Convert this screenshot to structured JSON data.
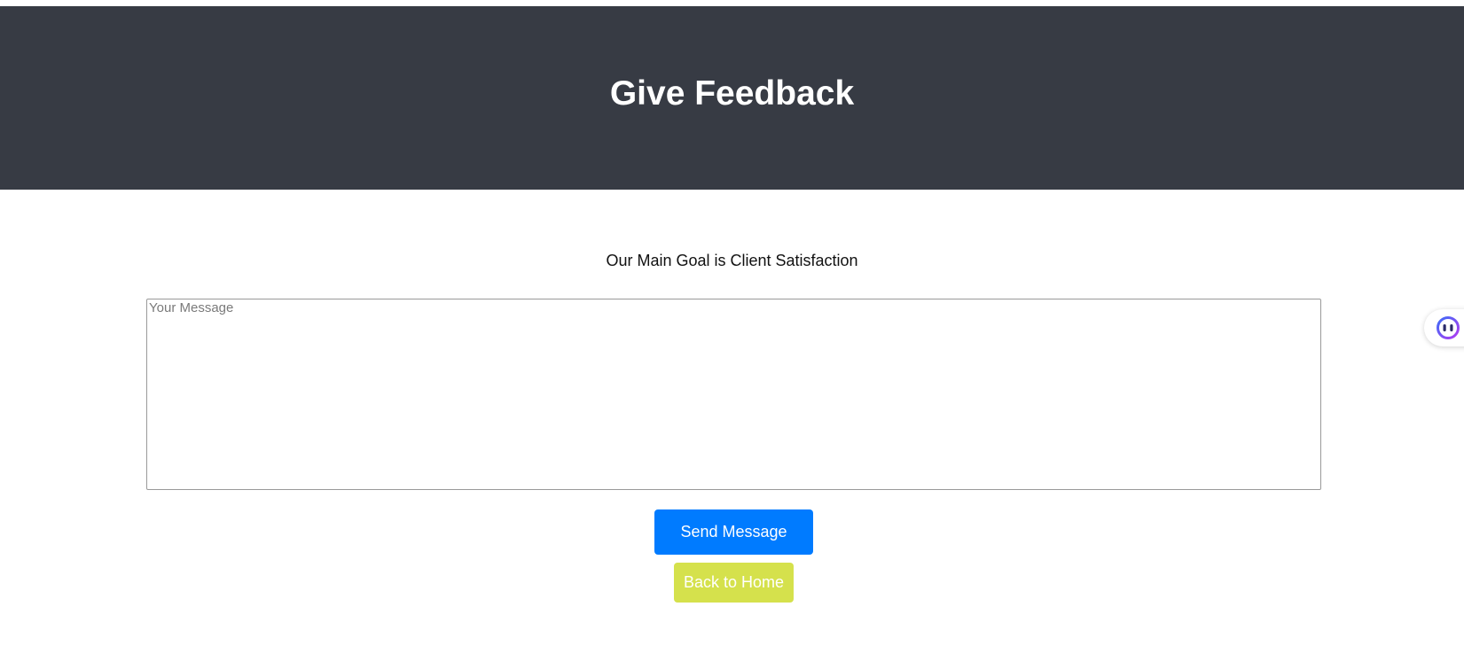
{
  "header": {
    "title": "Give Feedback",
    "background_color": "#373b44"
  },
  "main": {
    "subtitle": "Our Main Goal is Client Satisfaction",
    "message_input": {
      "placeholder": "Your Message",
      "value": ""
    },
    "send_button": {
      "label": "Send Message",
      "color": "#007bff"
    },
    "home_button": {
      "label": "Back to Home",
      "color": "#d5e14c"
    }
  },
  "widget": {
    "icon": "assistant-face-icon"
  }
}
